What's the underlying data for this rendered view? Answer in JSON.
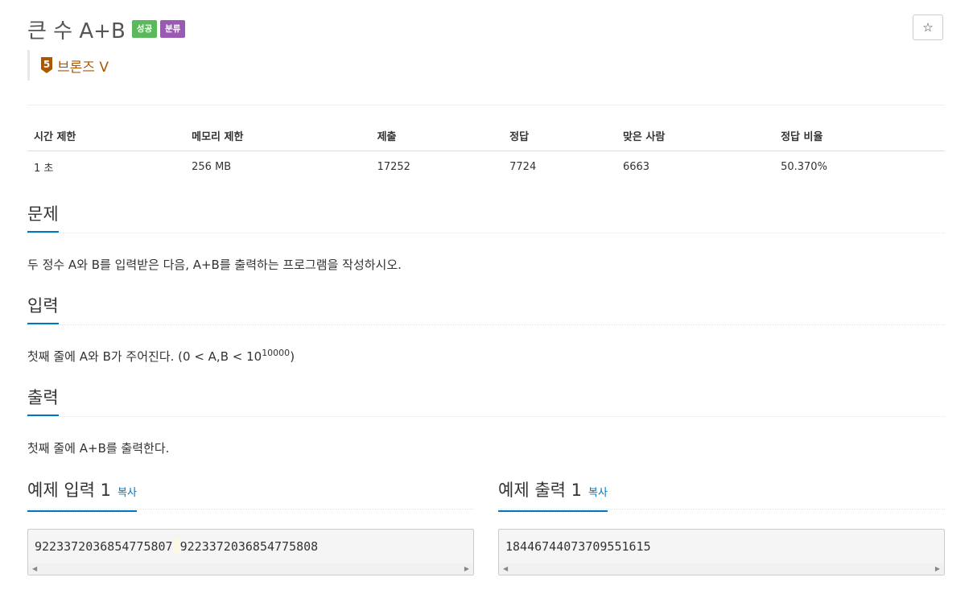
{
  "problem": {
    "title": "큰 수 A+B",
    "badges": {
      "success": "성공",
      "classify": "분류"
    },
    "star_icon": "☆",
    "tier": {
      "number": "5",
      "label": "브론즈 V",
      "color": "#ad5600"
    }
  },
  "info_table": {
    "headers": [
      "시간 제한",
      "메모리 제한",
      "제출",
      "정답",
      "맞은 사람",
      "정답 비율"
    ],
    "values": [
      "1 초",
      "256 MB",
      "17252",
      "7724",
      "6663",
      "50.370%"
    ]
  },
  "sections": {
    "problem": {
      "heading": "문제",
      "text": "두 정수 A와 B를 입력받은 다음, A+B를 출력하는 프로그램을 작성하시오."
    },
    "input": {
      "heading": "입력",
      "text": "첫째 줄에 A와 B가 주어진다. (0 < A,B < 10",
      "sup": "10000",
      "suffix": ")"
    },
    "output": {
      "heading": "출력",
      "text": "첫째 줄에 A+B를 출력한다."
    }
  },
  "samples": {
    "input": {
      "heading": "예제 입력 1",
      "copy": "복사",
      "part1": "9223372036854775807",
      "sep": " ",
      "part2": "9223372036854775808"
    },
    "output": {
      "heading": "예제 출력 1",
      "copy": "복사",
      "value": "18446744073709551615"
    }
  },
  "colors": {
    "accent": "#0076c0",
    "success": "#5cb85c",
    "classify": "#9b59b6"
  }
}
